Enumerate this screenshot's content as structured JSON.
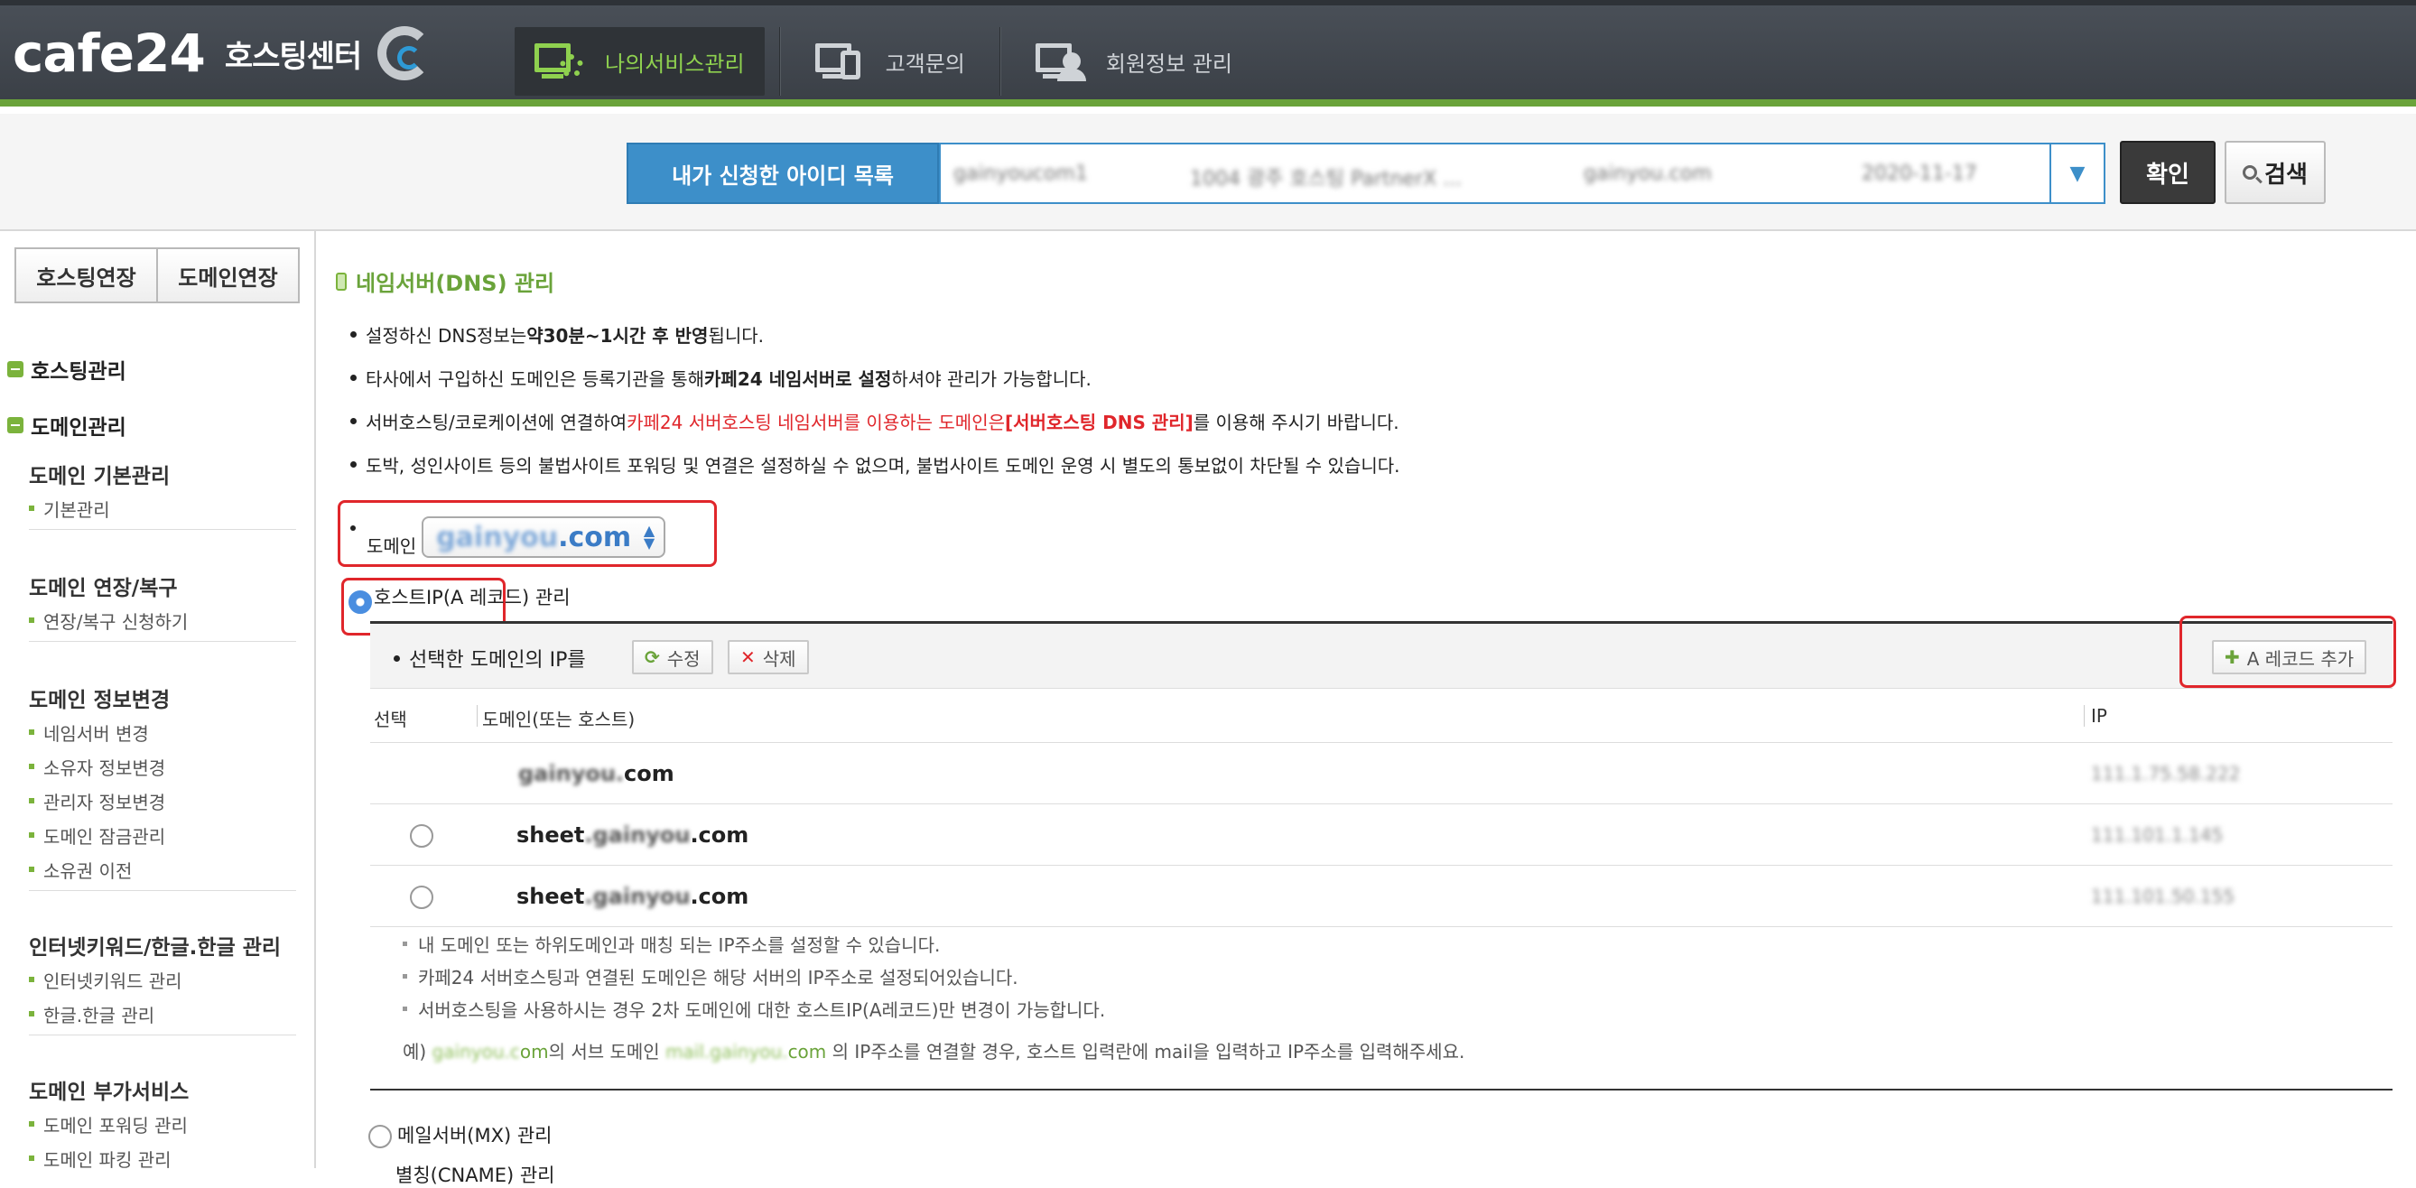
{
  "header": {
    "logo_text": "cafe24",
    "logo_sub": "호스팅센터",
    "nav": [
      {
        "label": "나의서비스관리",
        "icon": "monitor-gear-icon",
        "active": true
      },
      {
        "label": "고객문의",
        "icon": "monitor-phone-icon",
        "active": false
      },
      {
        "label": "회원정보 관리",
        "icon": "monitor-person-icon",
        "active": false
      }
    ],
    "accent_color": "#6aa33a"
  },
  "searchbar": {
    "id_list_label": "내가 신청한 아이디 목록",
    "selected_id_fields": [
      "gainyoucom1",
      "1004 광주 호스팅 PartnerX ...",
      "gainyou.com",
      "2020-11-17"
    ],
    "confirm_label": "확인",
    "search_label": "검색"
  },
  "sidebar": {
    "renew_tabs": [
      "호스팅연장",
      "도메인연장"
    ],
    "main_items": [
      "호스팅관리",
      "도메인관리"
    ],
    "groups": [
      {
        "title": "도메인 기본관리",
        "items": [
          "기본관리"
        ]
      },
      {
        "title": "도메인 연장/복구",
        "items": [
          "연장/복구 신청하기"
        ]
      },
      {
        "title": "도메인 정보변경",
        "items": [
          "네임서버 변경",
          "소유자 정보변경",
          "관리자 정보변경",
          "도메인 잠금관리",
          "소유권 이전"
        ]
      },
      {
        "title": "인터넷키워드/한글.한글 관리",
        "items": [
          "인터넷키워드 관리",
          "한글.한글 관리"
        ]
      },
      {
        "title": "도메인 부가서비스",
        "items": [
          "도메인 포워딩 관리",
          "도메인 파킹 관리"
        ]
      }
    ]
  },
  "main": {
    "title": "네임서버(DNS) 관리",
    "notices": {
      "n1_pre": "설정하신 DNS정보는 ",
      "n1_bold": "약30분~1시간 후 반영",
      "n1_post": "됩니다.",
      "n2_pre": "타사에서 구입하신 도메인은 등록기관을 통해 ",
      "n2_bold": "카페24 네임서버로 설정",
      "n2_post": "하셔야 관리가 가능합니다.",
      "n3_pre": "서버호스팅/코로케이션에 연결하여 ",
      "n3_red": "카페24 서버호스팅 네임서버를 이용하는 도메인은",
      "n3_redbold": "[서버호스팅 DNS 관리]",
      "n3_post": "를 이용해 주시기 바랍니다.",
      "n4": "도박, 성인사이트 등의 불법사이트 포워딩 및 연결은 설정하실 수 없으며, 불법사이트 도메인 운영 시 별도의 통보없이 차단될 수 있습니다."
    },
    "domain_label": "도메인",
    "domain_selected_blur": "gainyou",
    "domain_selected_suffix": ".com",
    "host_ip_label": "호스트IP(A 레코드) 관리",
    "panel": {
      "title": "선택한 도메인의 IP를",
      "edit_label": "수정",
      "delete_label": "삭제",
      "add_label": "A 레코드 추가",
      "columns": [
        "선택",
        "도메인(또는 호스트)",
        "IP"
      ],
      "rows": [
        {
          "prefix": "",
          "blur": "gainyou.",
          "suffix": "com",
          "ip": "111.1.75.58.222",
          "selectable": false
        },
        {
          "prefix": "sheet",
          "blur": ".gainyou",
          "suffix": ".com",
          "ip": "111.101.1.145",
          "selectable": true
        },
        {
          "prefix": "sheet",
          "blur": ".gainyou",
          "suffix": ".com",
          "ip": "111.101.50.155",
          "selectable": true
        }
      ],
      "tips": [
        "내 도메인 또는 하위도메인과 매칭 되는 IP주소를 설정할 수 있습니다.",
        "카페24 서버호스팅과 연결된 도메인은 해당 서버의 IP주소로 설정되어있습니다.",
        "서버호스팅을 사용하시는 경우 2차 도메인에 대한 호스트IP(A레코드)만 변경이 가능합니다."
      ],
      "example_pre": "예) ",
      "example_blur1": "gainyou.c",
      "example_g1": "om",
      "example_mid": "의 서브 도메인 ",
      "example_blur2": "mail.gainyou.",
      "example_g2": "com",
      "example_post": " 의 IP주소를 연결할 경우, 호스트 입력란에 mail을 입력하고 IP주소를 입력해주세요."
    },
    "mx_label": "메일서버(MX) 관리",
    "cname_label": "별칭(CNAME) 관리"
  }
}
